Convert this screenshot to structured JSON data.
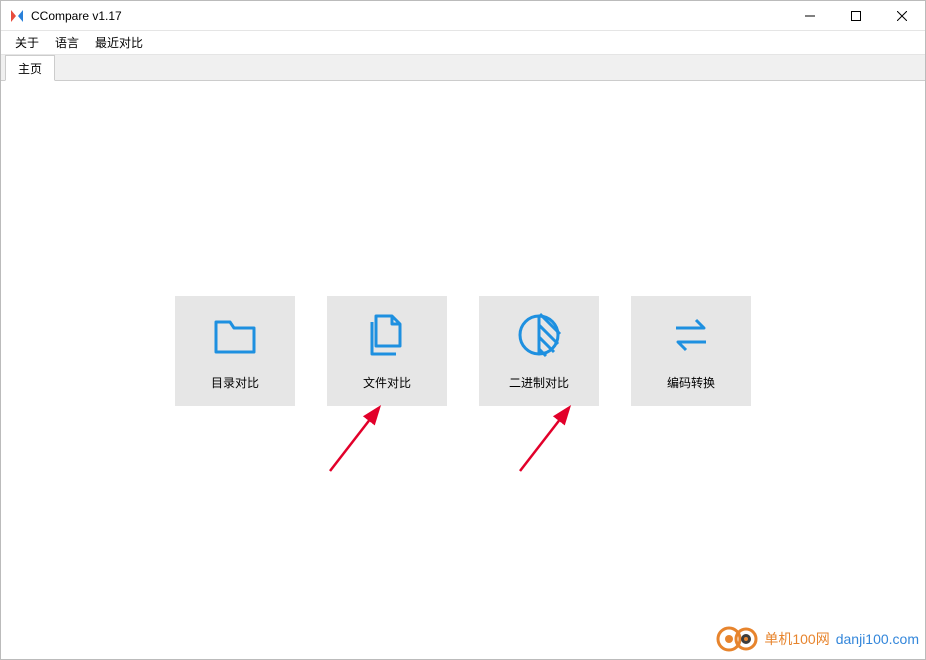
{
  "title": "CCompare  v1.17",
  "menu": {
    "about": "关于",
    "language": "语言",
    "recent": "最近对比"
  },
  "tabs": {
    "home": "主页"
  },
  "tiles": {
    "folder": "目录对比",
    "file": "文件对比",
    "binary": "二进制对比",
    "encoding": "编码转换"
  },
  "watermark": {
    "text": "单机100网",
    "url": "danji100.com"
  }
}
